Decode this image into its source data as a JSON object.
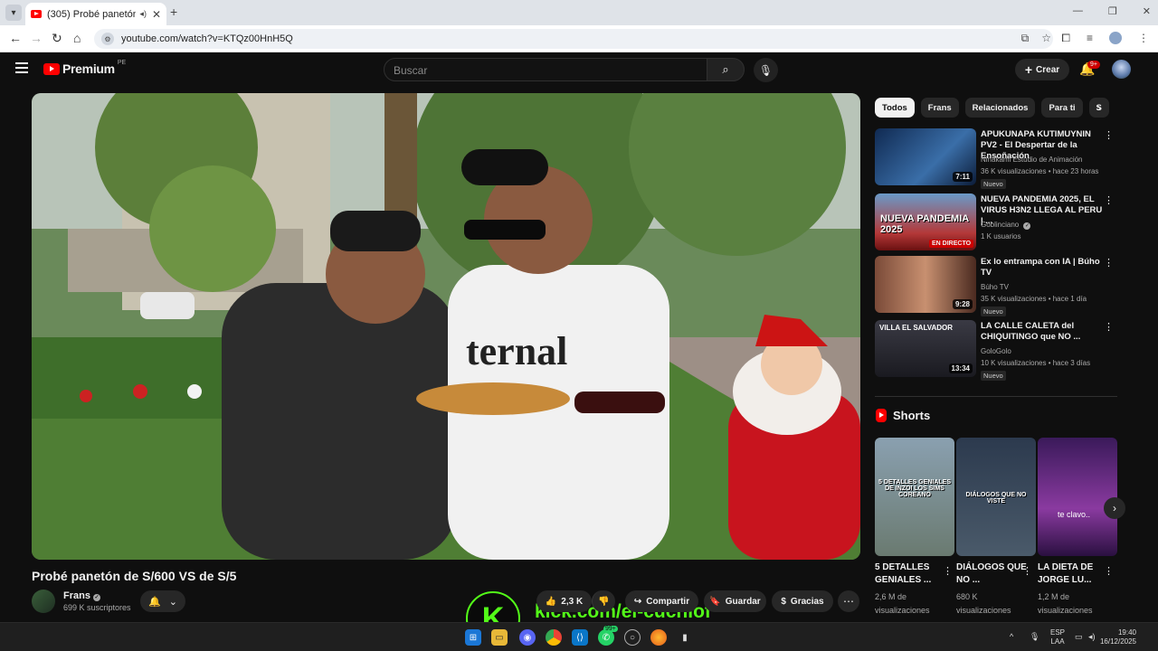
{
  "browser": {
    "tab_title": "(305) Probé panetón de S/6",
    "url": "youtube.com/watch?v=KTQz00HnH5Q"
  },
  "header": {
    "logo_text": "Premium",
    "country_code": "PE",
    "search_placeholder": "Buscar",
    "create_label": "Crear",
    "notif_count": "9+"
  },
  "video": {
    "title": "Probé panetón de S/600 VS de S/5",
    "channel_name": "Frans",
    "subscribers": "699 K suscriptores",
    "likes": "2,3 K",
    "share_label": "Compartir",
    "save_label": "Guardar",
    "thanks_label": "Gracias",
    "overlay_letter": "K",
    "overlay_url": "kick.com/el-cuchiof"
  },
  "chips": [
    "Todos",
    "Frans",
    "Relacionados",
    "Para ti",
    "S"
  ],
  "recommendations": [
    {
      "title": "APUKUNAPA KUTIMUYNIN PV2 - El Despertar de la Ensoñación",
      "channel": "Ninakami Estudio de Animación",
      "meta": "36 K visualizaciones • hace 23 horas",
      "badge": "Nuevo",
      "duration": "7:11",
      "thumb_color": "#1d3a6e"
    },
    {
      "title": "NUEVA PANDEMIA 2025, EL VIRUS H3N2 LLEGA AL PERU | ...",
      "channel": "Goblinciano",
      "meta": "1 K usuarios",
      "live_label": "EN DIRECTO",
      "thumb_text": "NUEVA PANDEMIA 2025",
      "thumb_color": "#2a5a8a"
    },
    {
      "title": "Ex lo entrampa con IA | Búho TV",
      "channel": "Búho TV",
      "meta": "35 K visualizaciones • hace 1 día",
      "badge": "Nuevo",
      "duration": "9:28",
      "thumb_color": "#4a3028"
    },
    {
      "title": "LA CALLE CALETA del CHIQUITINGO que NO ...",
      "channel": "GoloGolo",
      "meta": "10 K visualizaciones • hace 3 días",
      "badge": "Nuevo",
      "duration": "13:34",
      "thumb_text": "VILLA EL SALVADOR",
      "thumb_color": "#2b2b30"
    }
  ],
  "shorts": {
    "heading": "Shorts",
    "items": [
      {
        "title": "5 DETALLES GENIALES ...",
        "views": "2,6 M de visualizaciones",
        "caption": "5 DETALLES GENIALES DE INZOI LOS SIMS COREANO",
        "color": "#7a8f9e"
      },
      {
        "title": "DIÁLOGOS QUE NO ...",
        "views": "680 K visualizaciones",
        "caption": "DIÁLOGOS QUE NO VISTE",
        "color": "#3e4a5a"
      },
      {
        "title": "LA DIETA DE JORGE LU...",
        "views": "1,2 M de visualizaciones",
        "caption": "te clavo..",
        "color": "#4a2a6a"
      }
    ]
  },
  "taskbar": {
    "lang_top": "ESP",
    "lang_bottom": "LAA",
    "time": "19:40",
    "date": "16/12/2025",
    "whatsapp_badge": "99+"
  }
}
